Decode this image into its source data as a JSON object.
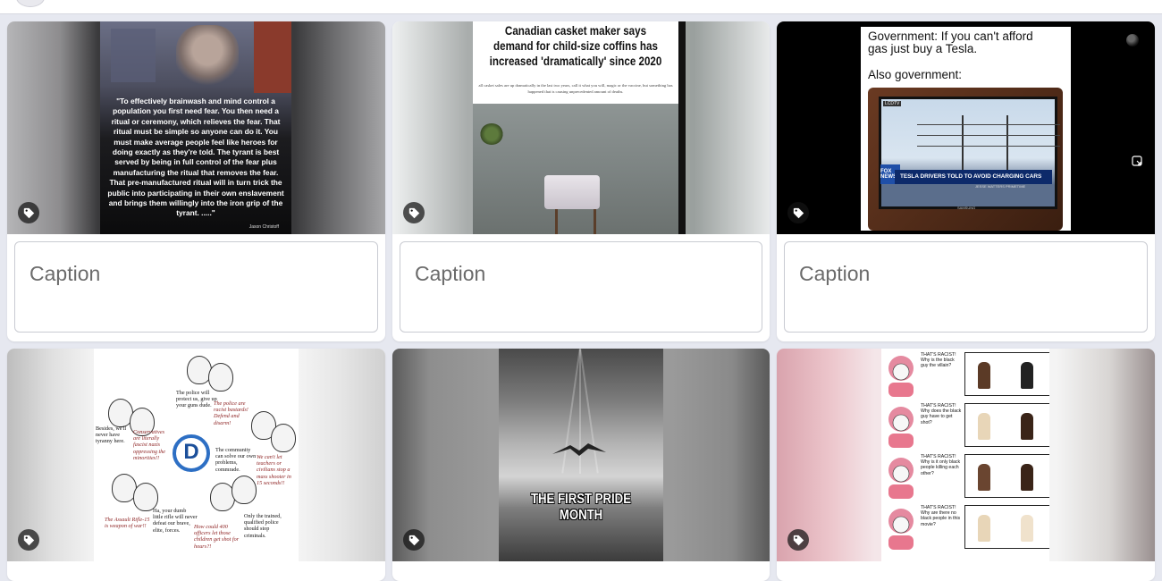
{
  "grid": {
    "caption_placeholder": "Caption",
    "cards": [
      {
        "quote": "\"To effectively brainwash and mind control a population you first need fear. You then need a ritual or ceremony, which relieves the fear. That ritual must be simple so anyone can do it. You must make average people feel like heroes for doing exactly as they're told. The tyrant is best served by being in full control of the fear plus manufacturing the ritual that removes the fear. That pre-manufactured ritual will in turn trick the public into participating in their own enslavement and brings them willingly into the iron grip of the tyrant. .....\"",
        "attribution": "Jason Christoff"
      },
      {
        "headline": "Canadian casket maker says demand for child-size coffins has increased 'dramatically' since 2020",
        "subtext": "all casket sales are up dramatically in the last two years, call it what you will, magic or the vaccine, but something has happened that is causing unprecedented amount of deaths."
      },
      {
        "line1": "Government: If you can't afford gas just buy a Tesla.",
        "line2": "Also government:",
        "tv_brand": "LCDTV",
        "banner": "TESLA DRIVERS TOLD TO AVOID CHARGING CARS",
        "banner_sub": "JESSE WATTERS PRIMETIME",
        "logo": "FOX NEWS",
        "maker": "SAMSUNG"
      },
      {
        "t_police": "The police will protect us, give up your guns dude.",
        "t_bastards": "The police are racist bastards! Defend and disarm!",
        "t_besides": "Besides, we'll never have tyranny here.",
        "t_nazis": "Conservatives are literally fascist nazis oppressing the minorities!!",
        "t_community": "The community can solve our own problems, commrade.",
        "t_teachers": "We can't let teachers or civilians stop a mass shooter in 15 seconds!!",
        "t_ha": "Ha, your dumb little rifle will never defeat our brave, elite, forces.",
        "t_ar": "The Assault Rifle-15 is weapon of war!!",
        "t_400": "How could 400 officers let those children get shot for hours?!",
        "t_only": "Only the trained, qualified police should stop criminals.",
        "logo_letter": "D"
      },
      {
        "caption": "THE FIRST PRIDE MONTH"
      },
      {
        "rows": [
          "THAT'S RACIST! Why is the black guy the villain?",
          "THAT'S RACIST! Why does the black guy have to get shot?",
          "THAT'S RACIST! Why is it only black people killing each other?",
          "THAT'S RACIST! Why are there no black people in this movie?"
        ]
      }
    ]
  },
  "icons": {
    "tag": "tag-icon",
    "expand": "expand-icon",
    "badge": "bomb-icon"
  },
  "colors": {
    "page_bg": "#e6e8f0",
    "card_bg": "#ffffff",
    "caption_text": "#6b6b6b",
    "tag_bg": "#141414"
  }
}
